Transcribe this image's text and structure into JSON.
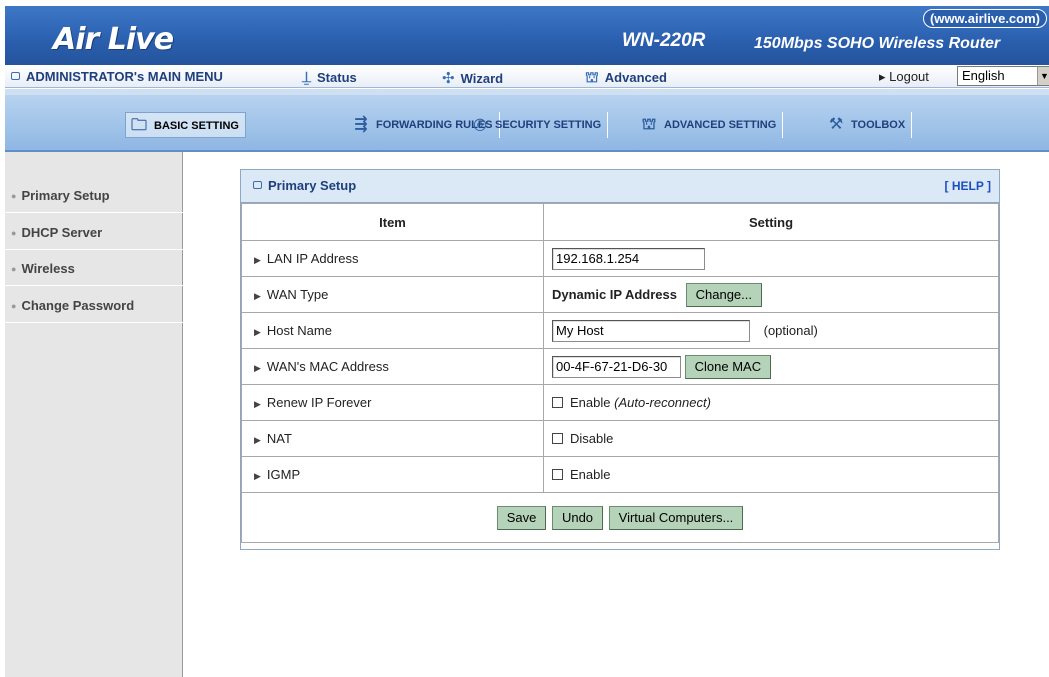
{
  "header": {
    "brand": "Air Live",
    "site_url": "(www.airlive.com)",
    "model": "WN-220R",
    "tagline": "150Mbps SOHO Wireless Router"
  },
  "main_menu": {
    "admin_label": "ADMINISTRATOR's MAIN MENU",
    "status_label": "Status",
    "wizard_label": "Wizard",
    "advanced_label": "Advanced",
    "logout_label": "▸ Logout",
    "language_value": "English"
  },
  "tabs": [
    {
      "label": "BASIC SETTING",
      "icon": "folder-icon"
    },
    {
      "label": "FORWARDING RULES",
      "icon": "forward-arrows-icon"
    },
    {
      "label": "SECURITY SETTING",
      "icon": "shield-eye-icon"
    },
    {
      "label": "ADVANCED SETTING",
      "icon": "advanced-icon"
    },
    {
      "label": "TOOLBOX",
      "icon": "toolbox-icon"
    }
  ],
  "sidebar": {
    "items": [
      {
        "label": "Primary Setup"
      },
      {
        "label": "DHCP Server"
      },
      {
        "label": "Wireless"
      },
      {
        "label": "Change Password"
      }
    ]
  },
  "panel": {
    "title": "Primary Setup",
    "help_label": "[ HELP ]",
    "col_item": "Item",
    "col_setting": "Setting"
  },
  "rows": {
    "lan_ip": {
      "label": "LAN IP Address",
      "value": "192.168.1.254"
    },
    "wan_type": {
      "label": "WAN Type",
      "value": "Dynamic IP Address",
      "button": "Change..."
    },
    "host_name": {
      "label": "Host Name",
      "value": "My Host",
      "hint": "(optional)"
    },
    "wan_mac": {
      "label": "WAN's MAC Address",
      "value": "00-4F-67-21-D6-30",
      "button": "Clone MAC"
    },
    "renew_ip": {
      "label": "Renew IP Forever",
      "checkbox_label": "Enable",
      "checkbox_note": "(Auto-reconnect)",
      "checked": false
    },
    "nat": {
      "label": "NAT",
      "checkbox_label": "Disable",
      "checked": false
    },
    "igmp": {
      "label": "IGMP",
      "checkbox_label": "Enable",
      "checked": false
    }
  },
  "actions": {
    "save_label": "Save",
    "undo_label": "Undo",
    "virtual_label": "Virtual Computers..."
  },
  "colors": {
    "header_blue": "#2a5fae",
    "tabbar_blue": "#a3c5ea",
    "button_green": "#b4d3b8",
    "panel_head": "#dbe8f6"
  }
}
